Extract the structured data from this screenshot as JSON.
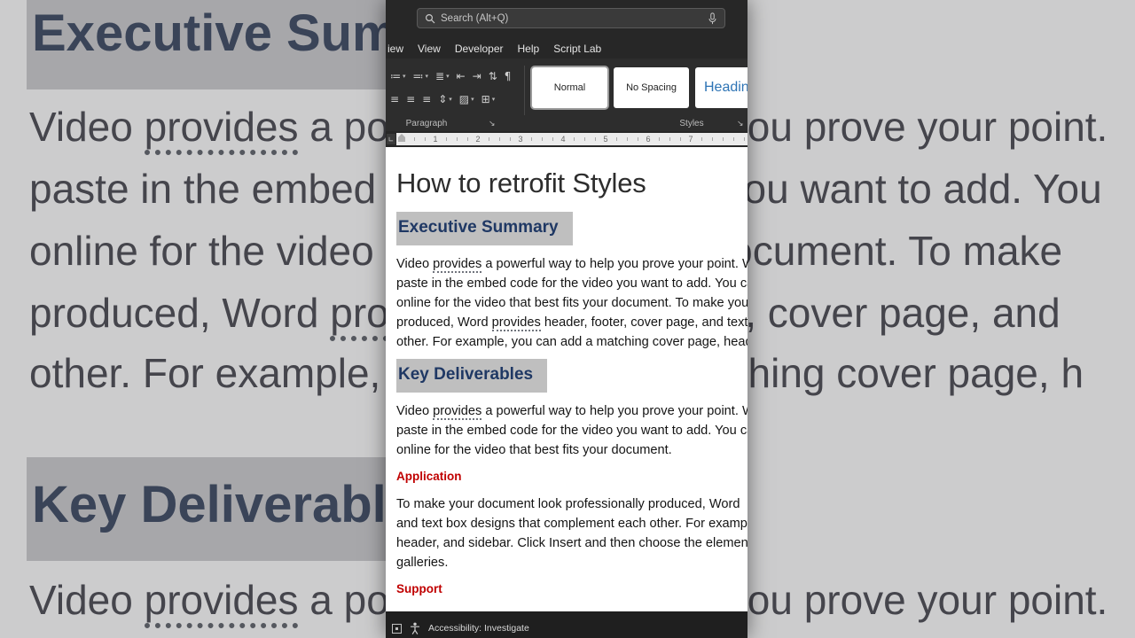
{
  "titlebar": {
    "search_placeholder": "Search (Alt+Q)"
  },
  "menu": {
    "tabs": [
      "iew",
      "View",
      "Developer",
      "Help",
      "Script Lab"
    ]
  },
  "ribbon": {
    "paragraph_label": "Paragraph",
    "styles_label": "Styles",
    "caret_glyph": "▾",
    "launcher_glyph": "↘",
    "tab_selector_glyph": "∟",
    "style_cards": [
      {
        "label": "Normal",
        "selected": true
      },
      {
        "label": "No Spacing",
        "selected": false
      },
      {
        "label": "Heading",
        "selected": false
      }
    ],
    "paragraph_rows": [
      [
        {
          "name": "bullets-icon",
          "glyph": "≔",
          "caret": true
        },
        {
          "name": "numbering-icon",
          "glyph": "≕",
          "caret": true
        },
        {
          "name": "multilevel-list-icon",
          "glyph": "≣",
          "caret": true
        },
        {
          "name": "decrease-indent-icon",
          "glyph": "⇤"
        },
        {
          "name": "increase-indent-icon",
          "glyph": "⇥"
        },
        {
          "name": "sort-icon",
          "glyph": "⇅"
        },
        {
          "name": "show-formatting-marks-icon",
          "glyph": "¶"
        }
      ],
      [
        {
          "name": "align-left-icon",
          "glyph": "≡"
        },
        {
          "name": "align-center-icon",
          "glyph": "≡"
        },
        {
          "name": "align-right-icon",
          "glyph": "≡"
        },
        {
          "name": "line-spacing-icon",
          "glyph": "⇕",
          "caret": true
        },
        {
          "name": "shading-icon",
          "glyph": "▨",
          "caret": true
        },
        {
          "name": "borders-icon",
          "glyph": "⊞",
          "caret": true
        }
      ]
    ]
  },
  "ruler": {
    "numbers": [
      "1",
      "2",
      "3",
      "4",
      "5",
      "6",
      "7"
    ]
  },
  "document": {
    "title": "How to retrofit Styles",
    "headings": [
      "Executive Summary",
      "Key Deliverables"
    ],
    "subheadings": [
      "Application",
      "Support"
    ],
    "paragraphs": [
      [
        [
          {
            "t": "Video "
          },
          {
            "t": "provides",
            "u": true
          },
          {
            "t": " a powerful way to help you prove your point. When"
          }
        ],
        [
          {
            "t": "paste in the embed code for the video you want to add. You can"
          }
        ],
        [
          {
            "t": "online for the video that best fits your document. To make your"
          }
        ],
        [
          {
            "t": "produced, Word "
          },
          {
            "t": "provides",
            "u": true
          },
          {
            "t": " header, footer, cover page, and text"
          }
        ],
        [
          {
            "t": "other. For example, you can add a matching cover page, header"
          }
        ]
      ],
      [
        [
          {
            "t": "Video "
          },
          {
            "t": "provides",
            "u": true
          },
          {
            "t": " a powerful way to help you prove your point. When"
          }
        ],
        [
          {
            "t": "paste in the embed code for the video you want to add. You can"
          }
        ],
        [
          {
            "t": "online for the video that best fits your document."
          }
        ]
      ],
      [
        [
          {
            "t": "To make your document look professionally produced, Word"
          }
        ],
        [
          {
            "t": "and text box designs that complement each other. For example"
          }
        ],
        [
          {
            "t": "header, and sidebar. Click Insert and then choose the elements"
          }
        ],
        [
          {
            "t": "galleries."
          }
        ]
      ]
    ]
  },
  "background": {
    "heading1": [
      {
        "t": "Executive Summary"
      }
    ],
    "heading2": [
      {
        "t": "Key Deliverables"
      }
    ],
    "lines": [
      [
        {
          "t": "Video "
        },
        {
          "t": "provides",
          "u": true
        },
        {
          "t": " a powerful way to help you prove your point."
        }
      ],
      [
        {
          "t": "paste in the embed code for the video you want to add. You"
        }
      ],
      [
        {
          "t": "online for the video that best fits your document. To make"
        }
      ],
      [
        {
          "t": "produced, Word "
        },
        {
          "t": "provides",
          "u": true
        },
        {
          "t": " header, footer, cover page, and"
        }
      ],
      [
        {
          "t": "other. For example, you can add a matching cover page, h"
        }
      ],
      [
        {
          "t": "Video "
        },
        {
          "t": "provides",
          "u": true
        },
        {
          "t": " a powerful way to help you prove your point."
        }
      ]
    ]
  },
  "statusbar": {
    "accessibility_label": "Accessibility: Investigate"
  },
  "colors": {
    "heading_navy": "#1f3864",
    "highlight_gray": "#bfbfbf",
    "accent_red": "#c00000",
    "style_heading_blue": "#2e74b5"
  }
}
